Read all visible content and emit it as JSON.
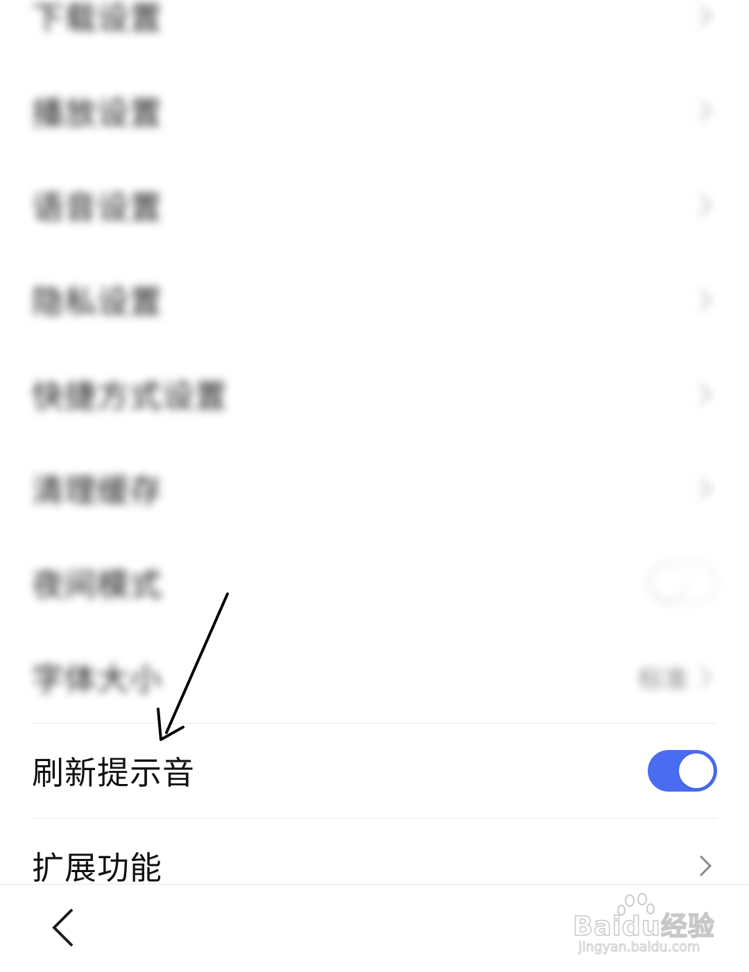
{
  "settings": {
    "blurred_items": [
      {
        "label": "下载设置",
        "control": "chevron"
      },
      {
        "label": "播放设置",
        "control": "chevron"
      },
      {
        "label": "语音设置",
        "control": "chevron"
      },
      {
        "label": "隐私设置",
        "control": "chevron"
      },
      {
        "label": "快捷方式设置",
        "control": "chevron"
      },
      {
        "label": "清理缓存",
        "control": "chevron"
      },
      {
        "label": "夜间模式",
        "control": "toggle",
        "toggle_on": false
      },
      {
        "label": "字体大小",
        "control": "chevron",
        "value": "标准"
      }
    ],
    "refresh_sound": {
      "label": "刷新提示音",
      "toggle_on": true
    },
    "extensions": {
      "label": "扩展功能"
    }
  },
  "nav": {
    "back_icon": "chevron-left-icon"
  },
  "annotation": {
    "icon": "arrow-annotation-icon"
  },
  "watermark": {
    "brand": "Baidu经验",
    "url": "jingyan.baidu.com"
  },
  "colors": {
    "toggle_on": "#4a6cf0",
    "text_primary": "#111111",
    "chevron": "#9a9a9a",
    "divider": "#ececec"
  }
}
